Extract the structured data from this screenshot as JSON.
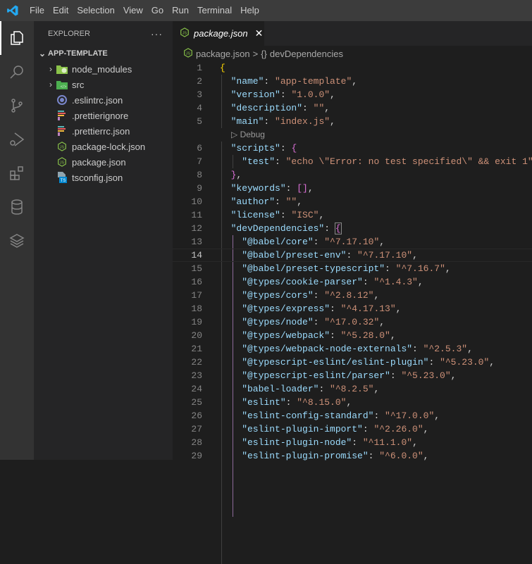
{
  "menu": [
    "File",
    "Edit",
    "Selection",
    "View",
    "Go",
    "Run",
    "Terminal",
    "Help"
  ],
  "sidebar": {
    "title": "EXPLORER",
    "more": "···",
    "folder": "APP-TEMPLATE",
    "items": [
      {
        "label": "node_modules",
        "icon": "folder-node-icon",
        "type": "folder"
      },
      {
        "label": "src",
        "icon": "folder-src-icon",
        "type": "folder"
      },
      {
        "label": ".eslintrc.json",
        "icon": "eslint-icon",
        "type": "file"
      },
      {
        "label": ".prettierignore",
        "icon": "prettier-icon",
        "type": "file"
      },
      {
        "label": ".prettierrc.json",
        "icon": "prettier-icon",
        "type": "file"
      },
      {
        "label": "package-lock.json",
        "icon": "nodejs-icon",
        "type": "file"
      },
      {
        "label": "package.json",
        "icon": "nodejs-icon",
        "type": "file"
      },
      {
        "label": "tsconfig.json",
        "icon": "tsconfig-icon",
        "type": "file"
      }
    ]
  },
  "tab": {
    "label": "package.json",
    "close": "✕"
  },
  "breadcrumb": {
    "file": "package.json",
    "sep": ">",
    "symbol": "{}",
    "node": "devDependencies"
  },
  "codelens": "▷ Debug",
  "colors": {
    "key": "#9cdcfe",
    "string": "#ce9178",
    "accent": "#007acc"
  },
  "current_line": 14,
  "code": [
    [
      [
        "{",
        "b1"
      ]
    ],
    [
      [
        "  \"name\"",
        "k"
      ],
      [
        ": ",
        "p"
      ],
      [
        "\"app-template\"",
        "s"
      ],
      [
        ",",
        "p"
      ]
    ],
    [
      [
        "  \"version\"",
        "k"
      ],
      [
        ": ",
        "p"
      ],
      [
        "\"1.0.0\"",
        "s"
      ],
      [
        ",",
        "p"
      ]
    ],
    [
      [
        "  \"description\"",
        "k"
      ],
      [
        ": ",
        "p"
      ],
      [
        "\"\"",
        "s"
      ],
      [
        ",",
        "p"
      ]
    ],
    [
      [
        "  \"main\"",
        "k"
      ],
      [
        ": ",
        "p"
      ],
      [
        "\"index.js\"",
        "s"
      ],
      [
        ",",
        "p"
      ]
    ],
    [
      [
        "  \"scripts\"",
        "k"
      ],
      [
        ": ",
        "p"
      ],
      [
        "{",
        "b2"
      ]
    ],
    [
      [
        "    \"test\"",
        "k"
      ],
      [
        ": ",
        "p"
      ],
      [
        "\"echo \\\"Error: no test specified\\\" && exit 1\"",
        "s"
      ]
    ],
    [
      [
        "  ",
        "p"
      ],
      [
        "}",
        "b2"
      ],
      [
        ",",
        "p"
      ]
    ],
    [
      [
        "  \"keywords\"",
        "k"
      ],
      [
        ": ",
        "p"
      ],
      [
        "[]",
        "b2"
      ],
      [
        ",",
        "p"
      ]
    ],
    [
      [
        "  \"author\"",
        "k"
      ],
      [
        ": ",
        "p"
      ],
      [
        "\"\"",
        "s"
      ],
      [
        ",",
        "p"
      ]
    ],
    [
      [
        "  \"license\"",
        "k"
      ],
      [
        ": ",
        "p"
      ],
      [
        "\"ISC\"",
        "s"
      ],
      [
        ",",
        "p"
      ]
    ],
    [
      [
        "  \"devDependencies\"",
        "k"
      ],
      [
        ": ",
        "p"
      ],
      [
        "{",
        "b3"
      ]
    ],
    [
      [
        "    \"@babel/core\"",
        "k"
      ],
      [
        ": ",
        "p"
      ],
      [
        "\"^7.17.10\"",
        "s"
      ],
      [
        ",",
        "p"
      ]
    ],
    [
      [
        "    \"@babel/preset-env\"",
        "k"
      ],
      [
        ": ",
        "p"
      ],
      [
        "\"^7.17.10\"",
        "s"
      ],
      [
        ",",
        "p"
      ]
    ],
    [
      [
        "    \"@babel/preset-typescript\"",
        "k"
      ],
      [
        ": ",
        "p"
      ],
      [
        "\"^7.16.7\"",
        "s"
      ],
      [
        ",",
        "p"
      ]
    ],
    [
      [
        "    \"@types/cookie-parser\"",
        "k"
      ],
      [
        ": ",
        "p"
      ],
      [
        "\"^1.4.3\"",
        "s"
      ],
      [
        ",",
        "p"
      ]
    ],
    [
      [
        "    \"@types/cors\"",
        "k"
      ],
      [
        ": ",
        "p"
      ],
      [
        "\"^2.8.12\"",
        "s"
      ],
      [
        ",",
        "p"
      ]
    ],
    [
      [
        "    \"@types/express\"",
        "k"
      ],
      [
        ": ",
        "p"
      ],
      [
        "\"^4.17.13\"",
        "s"
      ],
      [
        ",",
        "p"
      ]
    ],
    [
      [
        "    \"@types/node\"",
        "k"
      ],
      [
        ": ",
        "p"
      ],
      [
        "\"^17.0.32\"",
        "s"
      ],
      [
        ",",
        "p"
      ]
    ],
    [
      [
        "    \"@types/webpack\"",
        "k"
      ],
      [
        ": ",
        "p"
      ],
      [
        "\"^5.28.0\"",
        "s"
      ],
      [
        ",",
        "p"
      ]
    ],
    [
      [
        "    \"@types/webpack-node-externals\"",
        "k"
      ],
      [
        ": ",
        "p"
      ],
      [
        "\"^2.5.3\"",
        "s"
      ],
      [
        ",",
        "p"
      ]
    ],
    [
      [
        "    \"@typescript-eslint/eslint-plugin\"",
        "k"
      ],
      [
        ": ",
        "p"
      ],
      [
        "\"^5.23.0\"",
        "s"
      ],
      [
        ",",
        "p"
      ]
    ],
    [
      [
        "    \"@typescript-eslint/parser\"",
        "k"
      ],
      [
        ": ",
        "p"
      ],
      [
        "\"^5.23.0\"",
        "s"
      ],
      [
        ",",
        "p"
      ]
    ],
    [
      [
        "    \"babel-loader\"",
        "k"
      ],
      [
        ": ",
        "p"
      ],
      [
        "\"^8.2.5\"",
        "s"
      ],
      [
        ",",
        "p"
      ]
    ],
    [
      [
        "    \"eslint\"",
        "k"
      ],
      [
        ": ",
        "p"
      ],
      [
        "\"^8.15.0\"",
        "s"
      ],
      [
        ",",
        "p"
      ]
    ],
    [
      [
        "    \"eslint-config-standard\"",
        "k"
      ],
      [
        ": ",
        "p"
      ],
      [
        "\"^17.0.0\"",
        "s"
      ],
      [
        ",",
        "p"
      ]
    ],
    [
      [
        "    \"eslint-plugin-import\"",
        "k"
      ],
      [
        ": ",
        "p"
      ],
      [
        "\"^2.26.0\"",
        "s"
      ],
      [
        ",",
        "p"
      ]
    ],
    [
      [
        "    \"eslint-plugin-node\"",
        "k"
      ],
      [
        ": ",
        "p"
      ],
      [
        "\"^11.1.0\"",
        "s"
      ],
      [
        ",",
        "p"
      ]
    ],
    [
      [
        "    \"eslint-plugin-promise\"",
        "k"
      ],
      [
        ": ",
        "p"
      ],
      [
        "\"^6.0.0\"",
        "s"
      ],
      [
        ",",
        "p"
      ]
    ]
  ]
}
